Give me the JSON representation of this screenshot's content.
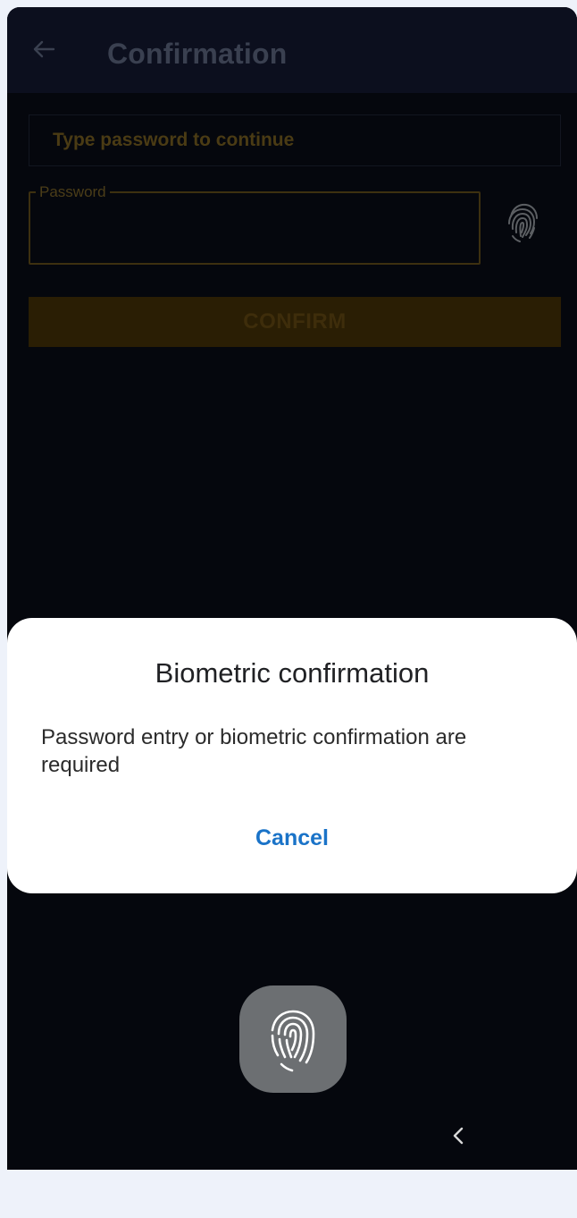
{
  "header": {
    "title": "Confirmation",
    "back_icon": "arrow-left-icon"
  },
  "form": {
    "hint": "Type password to continue",
    "password_label": "Password",
    "password_value": "",
    "fingerprint_icon": "fingerprint-icon",
    "confirm_label": "CONFIRM"
  },
  "dialog": {
    "title": "Biometric confirmation",
    "message": "Password entry or biometric confirmation are required",
    "cancel_label": "Cancel"
  },
  "sensor": {
    "icon": "fingerprint-icon"
  },
  "navbar": {
    "back_icon": "chevron-left-icon"
  },
  "colors": {
    "accent_dim": "#4a3b14",
    "link": "#1a73c8",
    "background": "#05070d"
  }
}
